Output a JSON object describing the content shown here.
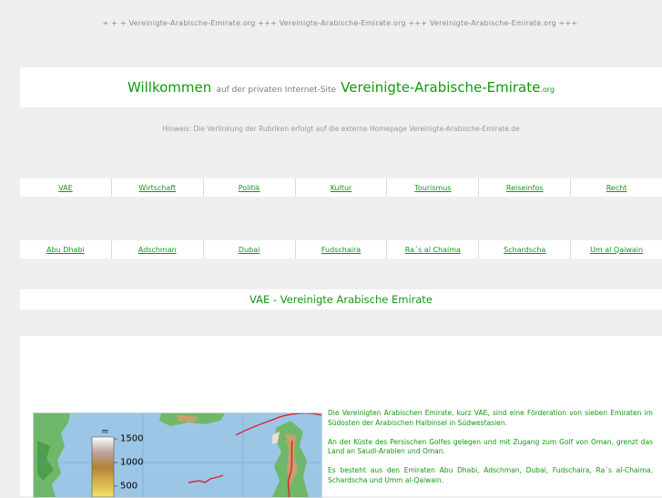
{
  "top_banner": "+ + +  Vereinigte-Arabische-Emirate.org  +++  Vereinigte-Arabische-Emirate.org  +++  Vereinigte-Arabische-Emirate.org  +++",
  "welcome": {
    "word": "Willkommen",
    "middle": "auf der privaten Internet-Site",
    "site": "Vereinigte-Arabische-Emirate",
    "tld": ".org"
  },
  "hint": "Hinweis: Die Verlinkung der Rubriken erfolgt auf die externe Homepage Vereinigte-Arabische-Emirate.de",
  "nav_row_1": [
    "VAE",
    "Wirtschaft",
    "Politik",
    "Kultur",
    "Tourismus",
    "Reiseinfos",
    "Recht"
  ],
  "nav_row_2": [
    "Abu Dhabi",
    "Adschman",
    "Dubai",
    "Fudschaira",
    "Ra´s al Chaima",
    "Schardscha",
    "Um al Qaiwain"
  ],
  "section_title": "VAE - Vereinigte Arabische Emirate",
  "map": {
    "legend_unit": "m",
    "legend_values": [
      "1500",
      "1000",
      "500"
    ],
    "colors": {
      "sea": "#9cc6e6",
      "land_low": "#6fb86a",
      "land_high": "#c9a06a",
      "border": "#e0202a"
    }
  },
  "paragraphs": [
    "Die Vereinigten Arabischen Emirate, kurz VAE, sind eine Förderation von sieben Emiraten im Südosten der Arabischen Halbinsel in Südwestasien.",
    "An der Küste des Persischen Golfes gelegen und mit Zugang zum Golf von Oman, grenzt das Land an Saudi-Arabien und Oman.",
    "Es besteht aus den Emiraten Abu Dhabi, Adschman, Dubai, Fudschaira, Ra´s al-Chaima, Schardscha und Umm al-Qaiwain."
  ]
}
